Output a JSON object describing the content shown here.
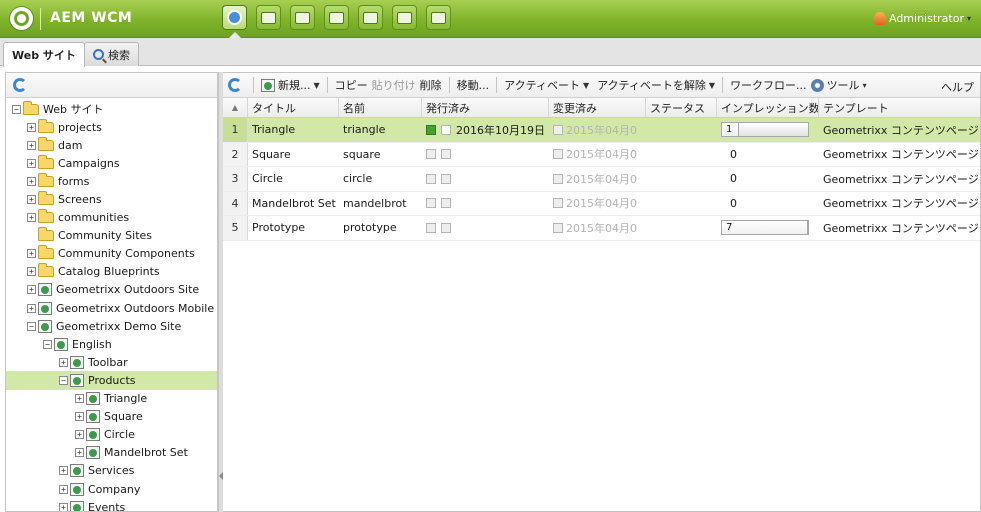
{
  "header": {
    "brand": "AEM WCM",
    "user": "Administrator",
    "app_icons": [
      "websites-icon",
      "digital-assets-icon",
      "campaigns-icon",
      "community-icon",
      "users-icon",
      "tools-icon",
      "tagging-icon"
    ]
  },
  "tabs": [
    {
      "label": "Web サイト",
      "active": true
    },
    {
      "label": "検索",
      "active": false
    }
  ],
  "tree": [
    {
      "label": "Web サイト",
      "depth": 0,
      "expander": "minus",
      "icon": "folder"
    },
    {
      "label": "projects",
      "depth": 1,
      "expander": "plus",
      "icon": "folder"
    },
    {
      "label": "dam",
      "depth": 1,
      "expander": "plus",
      "icon": "folder"
    },
    {
      "label": "Campaigns",
      "depth": 1,
      "expander": "plus",
      "icon": "folder"
    },
    {
      "label": "forms",
      "depth": 1,
      "expander": "plus",
      "icon": "folder"
    },
    {
      "label": "Screens",
      "depth": 1,
      "expander": "plus",
      "icon": "folder"
    },
    {
      "label": "communities",
      "depth": 1,
      "expander": "plus",
      "icon": "folder"
    },
    {
      "label": "Community Sites",
      "depth": 1,
      "expander": "none",
      "icon": "folder"
    },
    {
      "label": "Community Components",
      "depth": 1,
      "expander": "plus",
      "icon": "folder"
    },
    {
      "label": "Catalog Blueprints",
      "depth": 1,
      "expander": "plus",
      "icon": "folder"
    },
    {
      "label": "Geometrixx Outdoors Site",
      "depth": 1,
      "expander": "plus",
      "icon": "page"
    },
    {
      "label": "Geometrixx Outdoors Mobile Site",
      "depth": 1,
      "expander": "plus",
      "icon": "page"
    },
    {
      "label": "Geometrixx Demo Site",
      "depth": 1,
      "expander": "minus",
      "icon": "page"
    },
    {
      "label": "English",
      "depth": 2,
      "expander": "minus",
      "icon": "page"
    },
    {
      "label": "Toolbar",
      "depth": 3,
      "expander": "plus",
      "icon": "page"
    },
    {
      "label": "Products",
      "depth": 3,
      "expander": "minus",
      "icon": "page",
      "selected": true
    },
    {
      "label": "Triangle",
      "depth": 4,
      "expander": "plus",
      "icon": "page"
    },
    {
      "label": "Square",
      "depth": 4,
      "expander": "plus",
      "icon": "page"
    },
    {
      "label": "Circle",
      "depth": 4,
      "expander": "plus",
      "icon": "page"
    },
    {
      "label": "Mandelbrot Set",
      "depth": 4,
      "expander": "plus",
      "icon": "page"
    },
    {
      "label": "Services",
      "depth": 3,
      "expander": "plus",
      "icon": "page"
    },
    {
      "label": "Company",
      "depth": 3,
      "expander": "plus",
      "icon": "page"
    },
    {
      "label": "Events",
      "depth": 3,
      "expander": "plus",
      "icon": "page"
    }
  ],
  "toolbar": {
    "new_label": "新規...",
    "copy_label": "コピー",
    "paste_label": "貼り付け",
    "delete_label": "削除",
    "move_label": "移動...",
    "activate_label": "アクティベート",
    "deactivate_label": "アクティベートを解除",
    "workflow_label": "ワークフロー...",
    "tools_label": "ツール",
    "help_label": "ヘルプ"
  },
  "grid": {
    "columns": [
      "タイトル",
      "名前",
      "発行済み",
      "変更済み",
      "ステータス",
      "インプレッション数",
      "テンプレート"
    ],
    "rows": [
      {
        "num": "1",
        "title": "Triangle",
        "name": "triangle",
        "published": "2016年10月19日",
        "published_status": "green",
        "modified": "2015年04月0",
        "status": "",
        "impressions": "1",
        "impressions_bar": true,
        "impressions_fraction": 0.2,
        "template": "Geometrixx コンテンツページ",
        "selected": true
      },
      {
        "num": "2",
        "title": "Square",
        "name": "square",
        "published": "",
        "published_status": "none",
        "modified": "2015年04月0",
        "status": "",
        "impressions": "0",
        "impressions_bar": false,
        "impressions_fraction": 0,
        "template": "Geometrixx コンテンツページ",
        "selected": false
      },
      {
        "num": "3",
        "title": "Circle",
        "name": "circle",
        "published": "",
        "published_status": "none",
        "modified": "2015年04月0",
        "status": "",
        "impressions": "0",
        "impressions_bar": false,
        "impressions_fraction": 0,
        "template": "Geometrixx コンテンツページ",
        "selected": false
      },
      {
        "num": "4",
        "title": "Mandelbrot Set",
        "name": "mandelbrot",
        "published": "",
        "published_status": "none",
        "modified": "2015年04月0",
        "status": "",
        "impressions": "0",
        "impressions_bar": false,
        "impressions_fraction": 0,
        "template": "Geometrixx コンテンツページ",
        "selected": false
      },
      {
        "num": "5",
        "title": "Prototype",
        "name": "prototype",
        "published": "",
        "published_status": "none",
        "modified": "2015年04月0",
        "status": "",
        "impressions": "7",
        "impressions_bar": true,
        "impressions_fraction": 1.0,
        "template": "Geometrixx コンテンツページ",
        "selected": false
      }
    ]
  },
  "colors": {
    "header_green": "#7fb32b",
    "selection": "#d2e8a6",
    "published_green": "#46a12f"
  }
}
